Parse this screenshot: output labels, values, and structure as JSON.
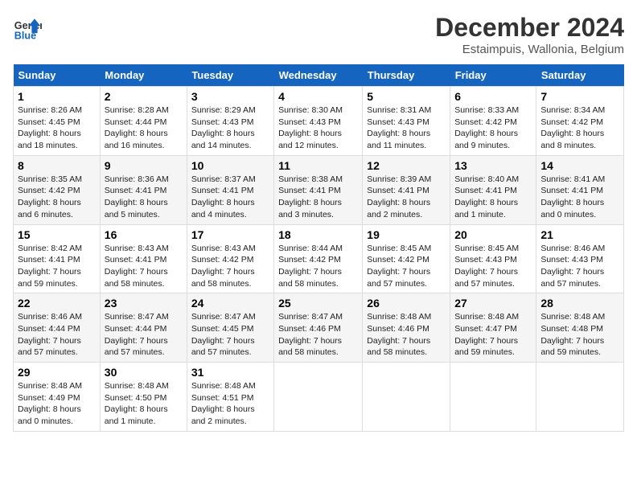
{
  "logo": {
    "line1": "General",
    "line2": "Blue"
  },
  "title": "December 2024",
  "subtitle": "Estaimpuis, Wallonia, Belgium",
  "days_of_week": [
    "Sunday",
    "Monday",
    "Tuesday",
    "Wednesday",
    "Thursday",
    "Friday",
    "Saturday"
  ],
  "weeks": [
    [
      {
        "day": "1",
        "sunrise": "8:26 AM",
        "sunset": "4:45 PM",
        "daylight": "8 hours and 18 minutes."
      },
      {
        "day": "2",
        "sunrise": "8:28 AM",
        "sunset": "4:44 PM",
        "daylight": "8 hours and 16 minutes."
      },
      {
        "day": "3",
        "sunrise": "8:29 AM",
        "sunset": "4:43 PM",
        "daylight": "8 hours and 14 minutes."
      },
      {
        "day": "4",
        "sunrise": "8:30 AM",
        "sunset": "4:43 PM",
        "daylight": "8 hours and 12 minutes."
      },
      {
        "day": "5",
        "sunrise": "8:31 AM",
        "sunset": "4:43 PM",
        "daylight": "8 hours and 11 minutes."
      },
      {
        "day": "6",
        "sunrise": "8:33 AM",
        "sunset": "4:42 PM",
        "daylight": "8 hours and 9 minutes."
      },
      {
        "day": "7",
        "sunrise": "8:34 AM",
        "sunset": "4:42 PM",
        "daylight": "8 hours and 8 minutes."
      }
    ],
    [
      {
        "day": "8",
        "sunrise": "8:35 AM",
        "sunset": "4:42 PM",
        "daylight": "8 hours and 6 minutes."
      },
      {
        "day": "9",
        "sunrise": "8:36 AM",
        "sunset": "4:41 PM",
        "daylight": "8 hours and 5 minutes."
      },
      {
        "day": "10",
        "sunrise": "8:37 AM",
        "sunset": "4:41 PM",
        "daylight": "8 hours and 4 minutes."
      },
      {
        "day": "11",
        "sunrise": "8:38 AM",
        "sunset": "4:41 PM",
        "daylight": "8 hours and 3 minutes."
      },
      {
        "day": "12",
        "sunrise": "8:39 AM",
        "sunset": "4:41 PM",
        "daylight": "8 hours and 2 minutes."
      },
      {
        "day": "13",
        "sunrise": "8:40 AM",
        "sunset": "4:41 PM",
        "daylight": "8 hours and 1 minute."
      },
      {
        "day": "14",
        "sunrise": "8:41 AM",
        "sunset": "4:41 PM",
        "daylight": "8 hours and 0 minutes."
      }
    ],
    [
      {
        "day": "15",
        "sunrise": "8:42 AM",
        "sunset": "4:41 PM",
        "daylight": "7 hours and 59 minutes."
      },
      {
        "day": "16",
        "sunrise": "8:43 AM",
        "sunset": "4:41 PM",
        "daylight": "7 hours and 58 minutes."
      },
      {
        "day": "17",
        "sunrise": "8:43 AM",
        "sunset": "4:42 PM",
        "daylight": "7 hours and 58 minutes."
      },
      {
        "day": "18",
        "sunrise": "8:44 AM",
        "sunset": "4:42 PM",
        "daylight": "7 hours and 58 minutes."
      },
      {
        "day": "19",
        "sunrise": "8:45 AM",
        "sunset": "4:42 PM",
        "daylight": "7 hours and 57 minutes."
      },
      {
        "day": "20",
        "sunrise": "8:45 AM",
        "sunset": "4:43 PM",
        "daylight": "7 hours and 57 minutes."
      },
      {
        "day": "21",
        "sunrise": "8:46 AM",
        "sunset": "4:43 PM",
        "daylight": "7 hours and 57 minutes."
      }
    ],
    [
      {
        "day": "22",
        "sunrise": "8:46 AM",
        "sunset": "4:44 PM",
        "daylight": "7 hours and 57 minutes."
      },
      {
        "day": "23",
        "sunrise": "8:47 AM",
        "sunset": "4:44 PM",
        "daylight": "7 hours and 57 minutes."
      },
      {
        "day": "24",
        "sunrise": "8:47 AM",
        "sunset": "4:45 PM",
        "daylight": "7 hours and 57 minutes."
      },
      {
        "day": "25",
        "sunrise": "8:47 AM",
        "sunset": "4:46 PM",
        "daylight": "7 hours and 58 minutes."
      },
      {
        "day": "26",
        "sunrise": "8:48 AM",
        "sunset": "4:46 PM",
        "daylight": "7 hours and 58 minutes."
      },
      {
        "day": "27",
        "sunrise": "8:48 AM",
        "sunset": "4:47 PM",
        "daylight": "7 hours and 59 minutes."
      },
      {
        "day": "28",
        "sunrise": "8:48 AM",
        "sunset": "4:48 PM",
        "daylight": "7 hours and 59 minutes."
      }
    ],
    [
      {
        "day": "29",
        "sunrise": "8:48 AM",
        "sunset": "4:49 PM",
        "daylight": "8 hours and 0 minutes."
      },
      {
        "day": "30",
        "sunrise": "8:48 AM",
        "sunset": "4:50 PM",
        "daylight": "8 hours and 1 minute."
      },
      {
        "day": "31",
        "sunrise": "8:48 AM",
        "sunset": "4:51 PM",
        "daylight": "8 hours and 2 minutes."
      },
      null,
      null,
      null,
      null
    ]
  ]
}
